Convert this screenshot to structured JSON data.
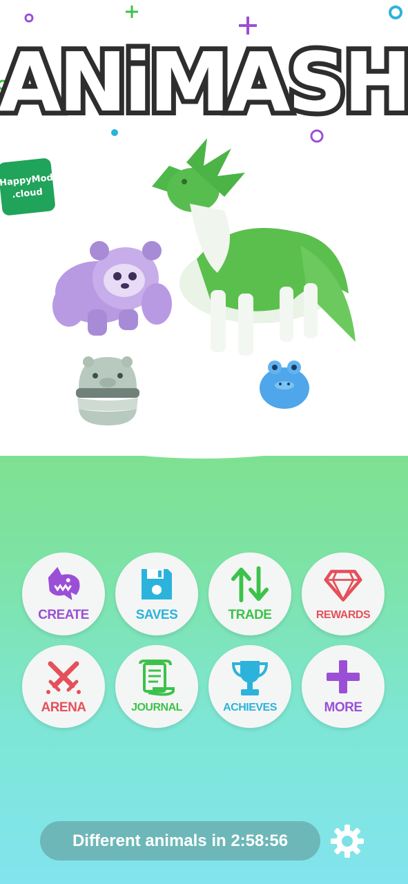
{
  "logo": {
    "text": "ANiMASH"
  },
  "watermark": {
    "line1": "HappyMod",
    "line2": ".cloud"
  },
  "menu": [
    {
      "id": "create",
      "label": "CREATE",
      "icon": "shark-icon",
      "color": "#9b4fd6"
    },
    {
      "id": "saves",
      "label": "SAVES",
      "icon": "floppy-disk-icon",
      "color": "#2bb3dc"
    },
    {
      "id": "trade",
      "label": "TRADE",
      "icon": "trade-arrows-icon",
      "color": "#3cc24a"
    },
    {
      "id": "rewards",
      "label": "REWARDS",
      "icon": "diamond-icon",
      "color": "#e5505a"
    },
    {
      "id": "arena",
      "label": "ARENA",
      "icon": "crossed-swords-icon",
      "color": "#e5505a"
    },
    {
      "id": "journal",
      "label": "JOURNAL",
      "icon": "scroll-icon",
      "color": "#3cc24a"
    },
    {
      "id": "achieves",
      "label": "ACHIEVES",
      "icon": "trophy-icon",
      "color": "#2bb3dc"
    },
    {
      "id": "more",
      "label": "MORE",
      "icon": "plus-icon",
      "color": "#9b4fd6"
    }
  ],
  "timer": {
    "prefix": "Different animals in ",
    "time": "2:58:56"
  },
  "colors": {
    "green": "#7fe08c",
    "cyan": "#82e4ee",
    "timer_bg": "#6eb7b8"
  }
}
